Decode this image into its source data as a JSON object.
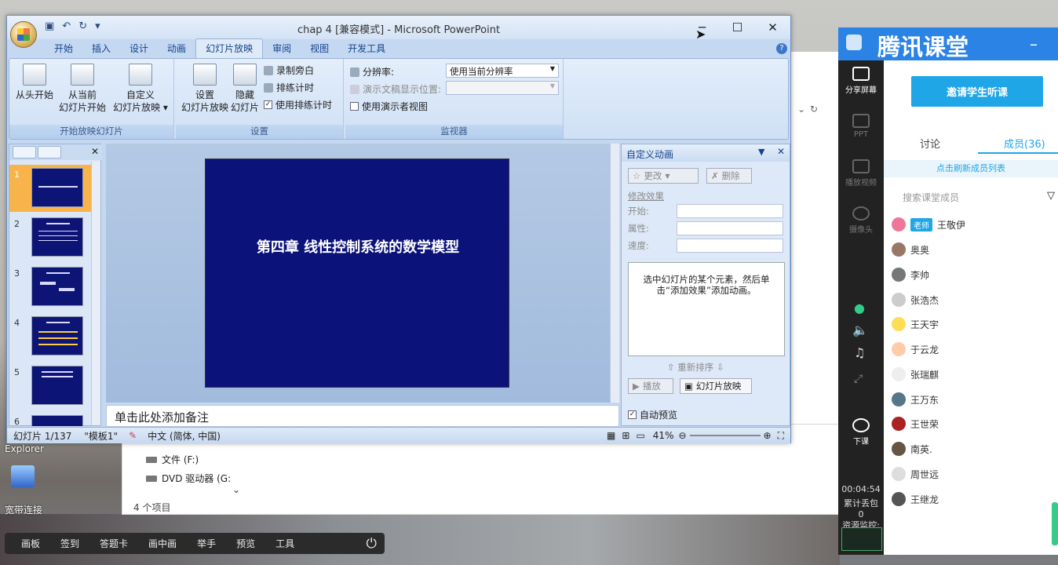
{
  "window": {
    "title": "chap 4 [兼容模式] - Microsoft PowerPoint"
  },
  "qat": [
    "save-icon",
    "undo-icon",
    "redo-icon"
  ],
  "tabs": [
    "开始",
    "插入",
    "设计",
    "动画",
    "幻灯片放映",
    "审阅",
    "视图",
    "开发工具"
  ],
  "ribbon": {
    "start_group": {
      "title": "开始放映幻灯片",
      "b1": "从头开始",
      "b2a": "从当前",
      "b2b": "幻灯片开始",
      "b3a": "自定义",
      "b3b": "幻灯片放映 ▾"
    },
    "setup_group": {
      "title": "设置",
      "b1a": "设置",
      "b1b": "幻灯片放映",
      "b2a": "隐藏",
      "b2b": "幻灯片",
      "s1": "录制旁白",
      "s2": "排练计时",
      "s3": "使用排练计时"
    },
    "monitor_group": {
      "title": "监视器",
      "res_label": "分辨率:",
      "res_value": "使用当前分辨率",
      "show_on_label": "演示文稿显示位置:",
      "presenter_label": "使用演示者视图"
    }
  },
  "thumbs": [
    "1",
    "2",
    "3",
    "4",
    "5",
    "6"
  ],
  "slide": {
    "title": "第四章 线性控制系统的数学模型"
  },
  "notes_placeholder": "单击此处添加备注",
  "anim_pane": {
    "title": "自定义动画",
    "change_btn": "更改",
    "delete_btn": "删除",
    "modify_label": "修改效果",
    "start_label": "开始:",
    "prop_label": "属性:",
    "speed_label": "速度:",
    "hint": "选中幻灯片的某个元素，然后单击“添加效果”添加动画。",
    "reorder": "重新排序",
    "play_btn": "播放",
    "show_btn": "幻灯片放映",
    "autopreview": "自动预览"
  },
  "status": {
    "slide": "幻灯片 1/137",
    "theme": "\"模板1\"",
    "lang": "中文 (简体, 中国)",
    "zoom": "41%"
  },
  "explorer": {
    "items": [
      "文件 (F:)",
      "DVD 驱动器 (G:"
    ],
    "count": "4 个项目"
  },
  "desktop": {
    "label1": "Explorer",
    "label2": "宽带连接"
  },
  "bottom_toolbar": [
    "画板",
    "签到",
    "答题卡",
    "画中画",
    "举手",
    "预览",
    "工具"
  ],
  "tencent": {
    "logo": "腾讯课堂",
    "side": {
      "share": "分享屏幕",
      "ppt": "PPT",
      "video": "播放视频",
      "camera": "摄像头",
      "end": "下课"
    },
    "invite": "邀请学生听课",
    "tab_discuss": "讨论",
    "tab_members": "成员(36)",
    "refresh": "点击刷新成员列表",
    "search_placeholder": "搜索课堂成员",
    "teacher_badge": "老师",
    "members": [
      "王敬伊",
      "奥奥",
      "李帅",
      "张浩杰",
      "王天宇",
      "于云龙",
      "张瑞麒",
      "王万东",
      "王世荣",
      "南英.",
      "周世远",
      "王继龙"
    ],
    "time": "00:04:54",
    "time_label1": "累计丢包",
    "time_label2": "0",
    "time_label3": "资源监控:"
  }
}
